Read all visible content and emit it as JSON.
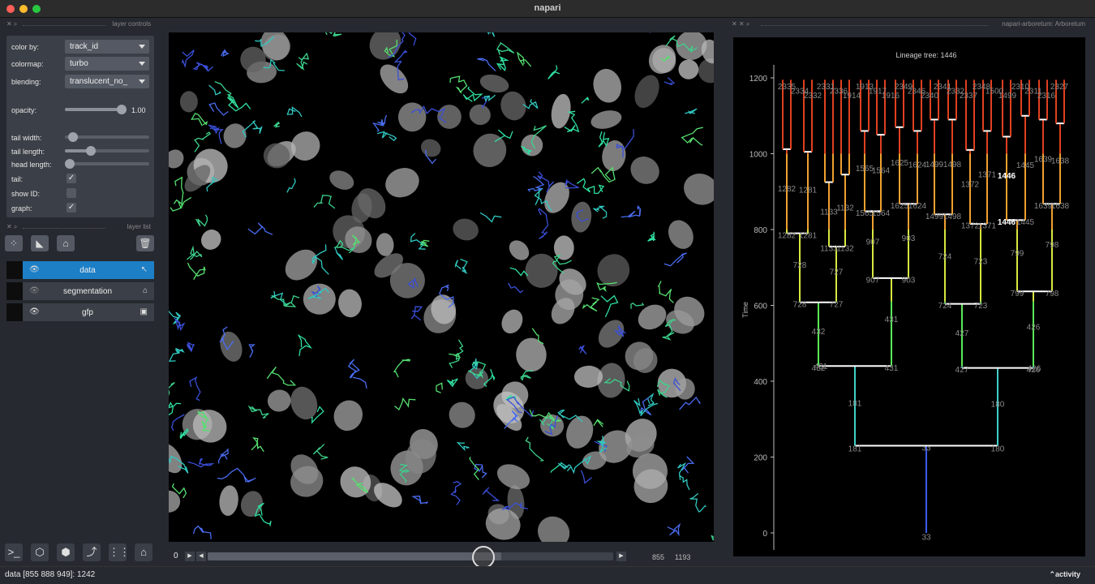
{
  "window": {
    "title": "napari"
  },
  "layer_controls": {
    "title": "layer controls",
    "color_by": {
      "label": "color by:",
      "value": "track_id"
    },
    "colormap": {
      "label": "colormap:",
      "value": "turbo"
    },
    "blending": {
      "label": "blending:",
      "value": "translucent_no_"
    },
    "opacity": {
      "label": "opacity:",
      "value": "1.00",
      "fraction": 1.0
    },
    "tail_width": {
      "label": "tail width:",
      "fraction": 0.08
    },
    "tail_length": {
      "label": "tail length:",
      "fraction": 0.3
    },
    "head_length": {
      "label": "head length:",
      "fraction": 0.0
    },
    "tail": {
      "label": "tail:",
      "checked": true
    },
    "show_id": {
      "label": "show ID:",
      "checked": false
    },
    "graph": {
      "label": "graph:",
      "checked": true
    }
  },
  "layer_list": {
    "title": "layer list",
    "layers": [
      {
        "name": "data",
        "selected": true,
        "visible": true,
        "type_icon": "tracks-icon"
      },
      {
        "name": "segmentation",
        "selected": false,
        "visible": false,
        "type_icon": "labels-icon"
      },
      {
        "name": "gfp",
        "selected": false,
        "visible": true,
        "type_icon": "image-icon"
      }
    ]
  },
  "viewer": {
    "current_frame": "0",
    "slider_value": "855",
    "slider_max": "1193",
    "slider_fraction": 0.72
  },
  "arboretum": {
    "title": "napari-arboretum: Arboretum",
    "chart_title": "Lineage tree: 1446"
  },
  "chart_data": {
    "type": "tree",
    "title": "Lineage tree: 1446",
    "ylabel": "Time",
    "ylim": [
      -30,
      1290
    ],
    "yticks": [
      0,
      200,
      400,
      600,
      800,
      1000,
      1200
    ],
    "root": {
      "id": "33",
      "t0": 0,
      "t1": 230
    },
    "children_level1": [
      {
        "id": "181",
        "t0": 230,
        "t1": 440
      },
      {
        "id": "180",
        "t0": 230,
        "t1": 435
      }
    ],
    "children_level2": [
      {
        "id": "432",
        "t0": 440,
        "t1": 608
      },
      {
        "id": "431",
        "t0": 440,
        "t1": 672
      },
      {
        "id": "427",
        "t0": 435,
        "t1": 604
      },
      {
        "id": "426",
        "t0": 435,
        "t1": 637
      }
    ],
    "children_level3": [
      {
        "id": "728",
        "t0": 608,
        "t1": 790
      },
      {
        "id": "727",
        "t0": 608,
        "t1": 755
      },
      {
        "id": "907",
        "t0": 672,
        "t1": 848
      },
      {
        "id": "903",
        "t0": 672,
        "t1": 868
      },
      {
        "id": "724",
        "t0": 604,
        "t1": 840
      },
      {
        "id": "723",
        "t0": 604,
        "t1": 815
      },
      {
        "id": "799",
        "t0": 637,
        "t1": 825
      },
      {
        "id": "798",
        "t0": 637,
        "t1": 868
      }
    ],
    "children_level4": [
      {
        "id": "1282",
        "t0": 790,
        "t1": 1012
      },
      {
        "id": "1281",
        "t0": 790,
        "t1": 1005
      },
      {
        "id": "1133",
        "t0": 755,
        "t1": 925
      },
      {
        "id": "1132",
        "t0": 755,
        "t1": 945
      },
      {
        "id": "1565",
        "t0": 848,
        "t1": 1060
      },
      {
        "id": "1564",
        "t0": 848,
        "t1": 1050
      },
      {
        "id": "1625",
        "t0": 868,
        "t1": 1070
      },
      {
        "id": "1624",
        "t0": 868,
        "t1": 1060
      },
      {
        "id": "1499",
        "t0": 840,
        "t1": 1090
      },
      {
        "id": "1498",
        "t0": 840,
        "t1": 1090
      },
      {
        "id": "1372",
        "t0": 815,
        "t1": 1010
      },
      {
        "id": "1371",
        "t0": 815,
        "t1": 1060
      },
      {
        "id": "1446",
        "t0": 825,
        "t1": 1045
      },
      {
        "id": "1445",
        "t0": 825,
        "t1": 1100
      },
      {
        "id": "1639",
        "t0": 868,
        "t1": 1090
      },
      {
        "id": "1638",
        "t0": 868,
        "t1": 1080
      }
    ],
    "tip_labels": [
      "2335",
      "2334",
      "2332",
      "2331",
      "2336",
      "1914",
      "1913",
      "1917",
      "1916",
      "2349",
      "2346",
      "2340",
      "2341",
      "2332",
      "2337",
      "2348",
      "1500",
      "1499",
      "2310",
      "2311",
      "2316",
      "2327"
    ]
  }
}
